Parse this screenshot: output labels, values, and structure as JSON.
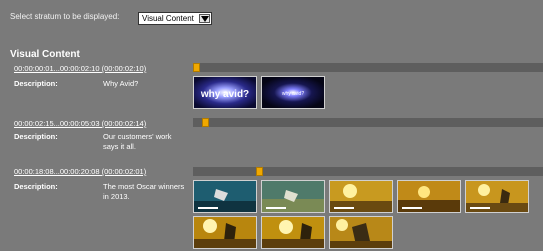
{
  "stratum": {
    "label": "Select stratum to be displayed:",
    "selected": "Visual Content"
  },
  "section_title": "Visual Content",
  "description_label": "Description:",
  "clips": [
    {
      "timecode": "00:00:00:01...00:00:02:10 (00:00:02:10)",
      "description": "Why Avid?",
      "marker_position": 0.0
    },
    {
      "timecode": "00:00:02:15...00:00:05:03 (00:00:02:14)",
      "description": "Our customers' work says it all.",
      "marker_position": 0.025
    },
    {
      "timecode": "00:00:18:08...00:00:20:08 (00:00:02:01)",
      "description": "The most Oscar winners in 2013.",
      "marker_position": 0.18
    }
  ],
  "thumb_overlay_text": "why avid?",
  "colors": {
    "background": "#7a7a7a",
    "timeline": "#5e5e5e",
    "marker": "#f0a800"
  }
}
